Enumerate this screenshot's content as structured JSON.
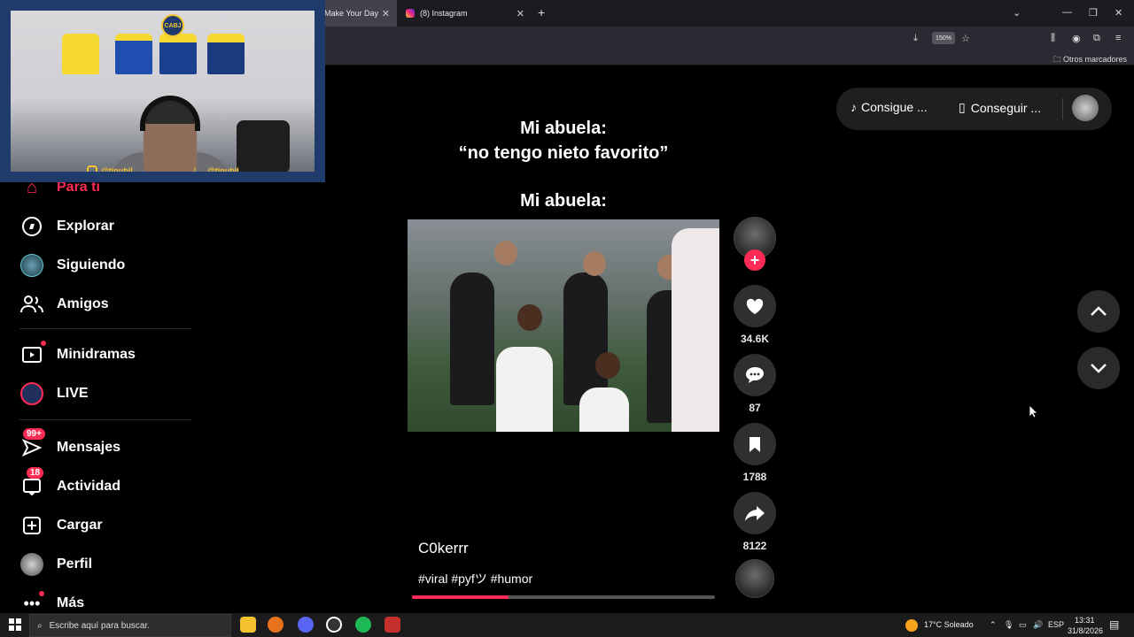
{
  "browser": {
    "tabs": [
      {
        "label": "Make Your Day",
        "active": true
      },
      {
        "label": "(8) Instagram",
        "active": false
      }
    ],
    "zoom": "150%",
    "bookmarks_other": "Otros marcadores"
  },
  "webcam": {
    "logo_text": "CABJ",
    "instagram_handle": "@tinubil_",
    "tiktok_handle": "@tinubil_"
  },
  "sidebar": {
    "items": [
      {
        "label": "Para ti",
        "icon": "home-icon",
        "active": true
      },
      {
        "label": "Explorar",
        "icon": "compass-icon"
      },
      {
        "label": "Siguiendo",
        "icon": "following-avatar-icon"
      },
      {
        "label": "Amigos",
        "icon": "friends-icon"
      },
      {
        "label": "Minidramas",
        "icon": "film-icon"
      },
      {
        "label": "LIVE",
        "icon": "live-icon"
      },
      {
        "label": "Mensajes",
        "icon": "messages-icon",
        "badge": "99+"
      },
      {
        "label": "Actividad",
        "icon": "activity-icon",
        "badge": "18"
      },
      {
        "label": "Cargar",
        "icon": "upload-icon"
      },
      {
        "label": "Perfil",
        "icon": "profile-avatar-icon"
      },
      {
        "label": "Más",
        "icon": "more-icon"
      }
    ]
  },
  "video": {
    "caption_line1": "Mi abuela:",
    "caption_line2": "“no tengo nieto favorito”",
    "caption_line3": "Mi abuela:",
    "author": "C0kerrr",
    "tags": "#viral #pyfツ #humor",
    "progress": 0.32
  },
  "actions": {
    "likes": "34.6K",
    "comments": "87",
    "saves": "1788",
    "shares": "8122"
  },
  "top_pill": {
    "coins_label": "Consigue ...",
    "app_label": "Conseguir ..."
  },
  "taskbar": {
    "search_placeholder": "Escribe aquí para buscar.",
    "weather": "17°C  Soleado",
    "language": "ESP",
    "time": "13:31",
    "date": "31/8/2026"
  },
  "colors": {
    "accent": "#fe2c55",
    "background": "#000000",
    "sidebar_active": "#fe2c55"
  }
}
